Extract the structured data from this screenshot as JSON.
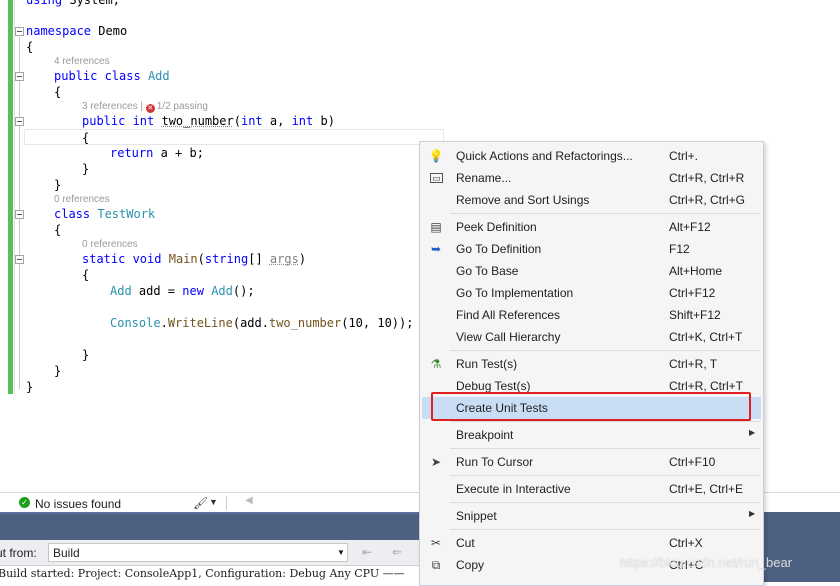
{
  "editor": {
    "lines": {
      "using": "using System;",
      "namespace": "namespace Demo",
      "brace_open": "{",
      "brace_close": "}",
      "class_add": "public class Add",
      "method_sig": "public int two_number(int a, int b)",
      "return_stmt": "return a + b;",
      "class_testwork": "class TestWork",
      "main_sig": "static void Main(string[] args)",
      "add_decl": "Add add = new Add();",
      "console_line": "Console.WriteLine(add.two_number(10, 10));"
    },
    "codelens": {
      "add_refs": "4 references",
      "two_number_refs": "3 references |",
      "two_number_tests": "1/2 passing",
      "testwork_refs": "0 references",
      "main_refs": "0 references"
    }
  },
  "status": {
    "issues": "No issues found"
  },
  "output": {
    "show_from_label": "ut from:",
    "show_from_value": "Build",
    "log_line": "Build started: Project: ConsoleApp1, Configuration: Debug Any CPU ——"
  },
  "context_menu": {
    "items": [
      {
        "label": "Quick Actions and Refactorings...",
        "shortcut": "Ctrl+.",
        "icon": "lightbulb-icon"
      },
      {
        "label": "Rename...",
        "shortcut": "Ctrl+R, Ctrl+R",
        "icon": "rename-icon"
      },
      {
        "label": "Remove and Sort Usings",
        "shortcut": "Ctrl+R, Ctrl+G",
        "icon": ""
      },
      {
        "label": "Peek Definition",
        "shortcut": "Alt+F12",
        "icon": "peek-definition-icon"
      },
      {
        "label": "Go To Definition",
        "shortcut": "F12",
        "icon": "go-to-definition-icon"
      },
      {
        "label": "Go To Base",
        "shortcut": "Alt+Home",
        "icon": ""
      },
      {
        "label": "Go To Implementation",
        "shortcut": "Ctrl+F12",
        "icon": ""
      },
      {
        "label": "Find All References",
        "shortcut": "Shift+F12",
        "icon": ""
      },
      {
        "label": "View Call Hierarchy",
        "shortcut": "Ctrl+K, Ctrl+T",
        "icon": ""
      },
      {
        "label": "Run Test(s)",
        "shortcut": "Ctrl+R, T",
        "icon": "run-test-icon"
      },
      {
        "label": "Debug Test(s)",
        "shortcut": "Ctrl+R, Ctrl+T",
        "icon": ""
      },
      {
        "label": "Create Unit Tests",
        "shortcut": "",
        "icon": ""
      },
      {
        "label": "Breakpoint",
        "shortcut": "",
        "icon": ""
      },
      {
        "label": "Run To Cursor",
        "shortcut": "Ctrl+F10",
        "icon": "cursor-icon"
      },
      {
        "label": "Execute in Interactive",
        "shortcut": "Ctrl+E, Ctrl+E",
        "icon": ""
      },
      {
        "label": "Snippet",
        "shortcut": "",
        "icon": ""
      },
      {
        "label": "Cut",
        "shortcut": "Ctrl+X",
        "icon": "scissors-icon"
      },
      {
        "label": "Copy",
        "shortcut": "Ctrl+C",
        "icon": "copy-icon"
      }
    ]
  },
  "watermark": "https://blog.csdn.net/run_bear",
  "colors": {
    "keyword": "#0000ff",
    "type": "#2b91af",
    "highlight_border": "#e02020",
    "menu_highlight": "#c9def5"
  }
}
